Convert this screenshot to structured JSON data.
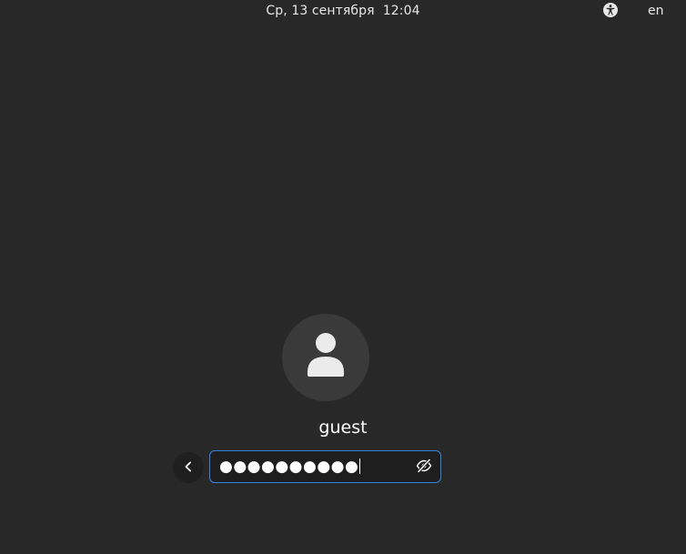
{
  "topbar": {
    "clock": "Ср, 13 сентября  12:04",
    "accessibility_icon": "accessibility-icon",
    "language": "en"
  },
  "login": {
    "avatar_icon": "user-icon",
    "username": "guest",
    "back_icon": "chevron-left-icon",
    "password_value": "●●●●●●●●●●",
    "reveal_icon": "eye-crossed-icon"
  },
  "colors": {
    "background": "#282828",
    "accent": "#3584e4",
    "avatar_bg": "#3a3a3a",
    "entry_bg": "#1e1e1e"
  }
}
